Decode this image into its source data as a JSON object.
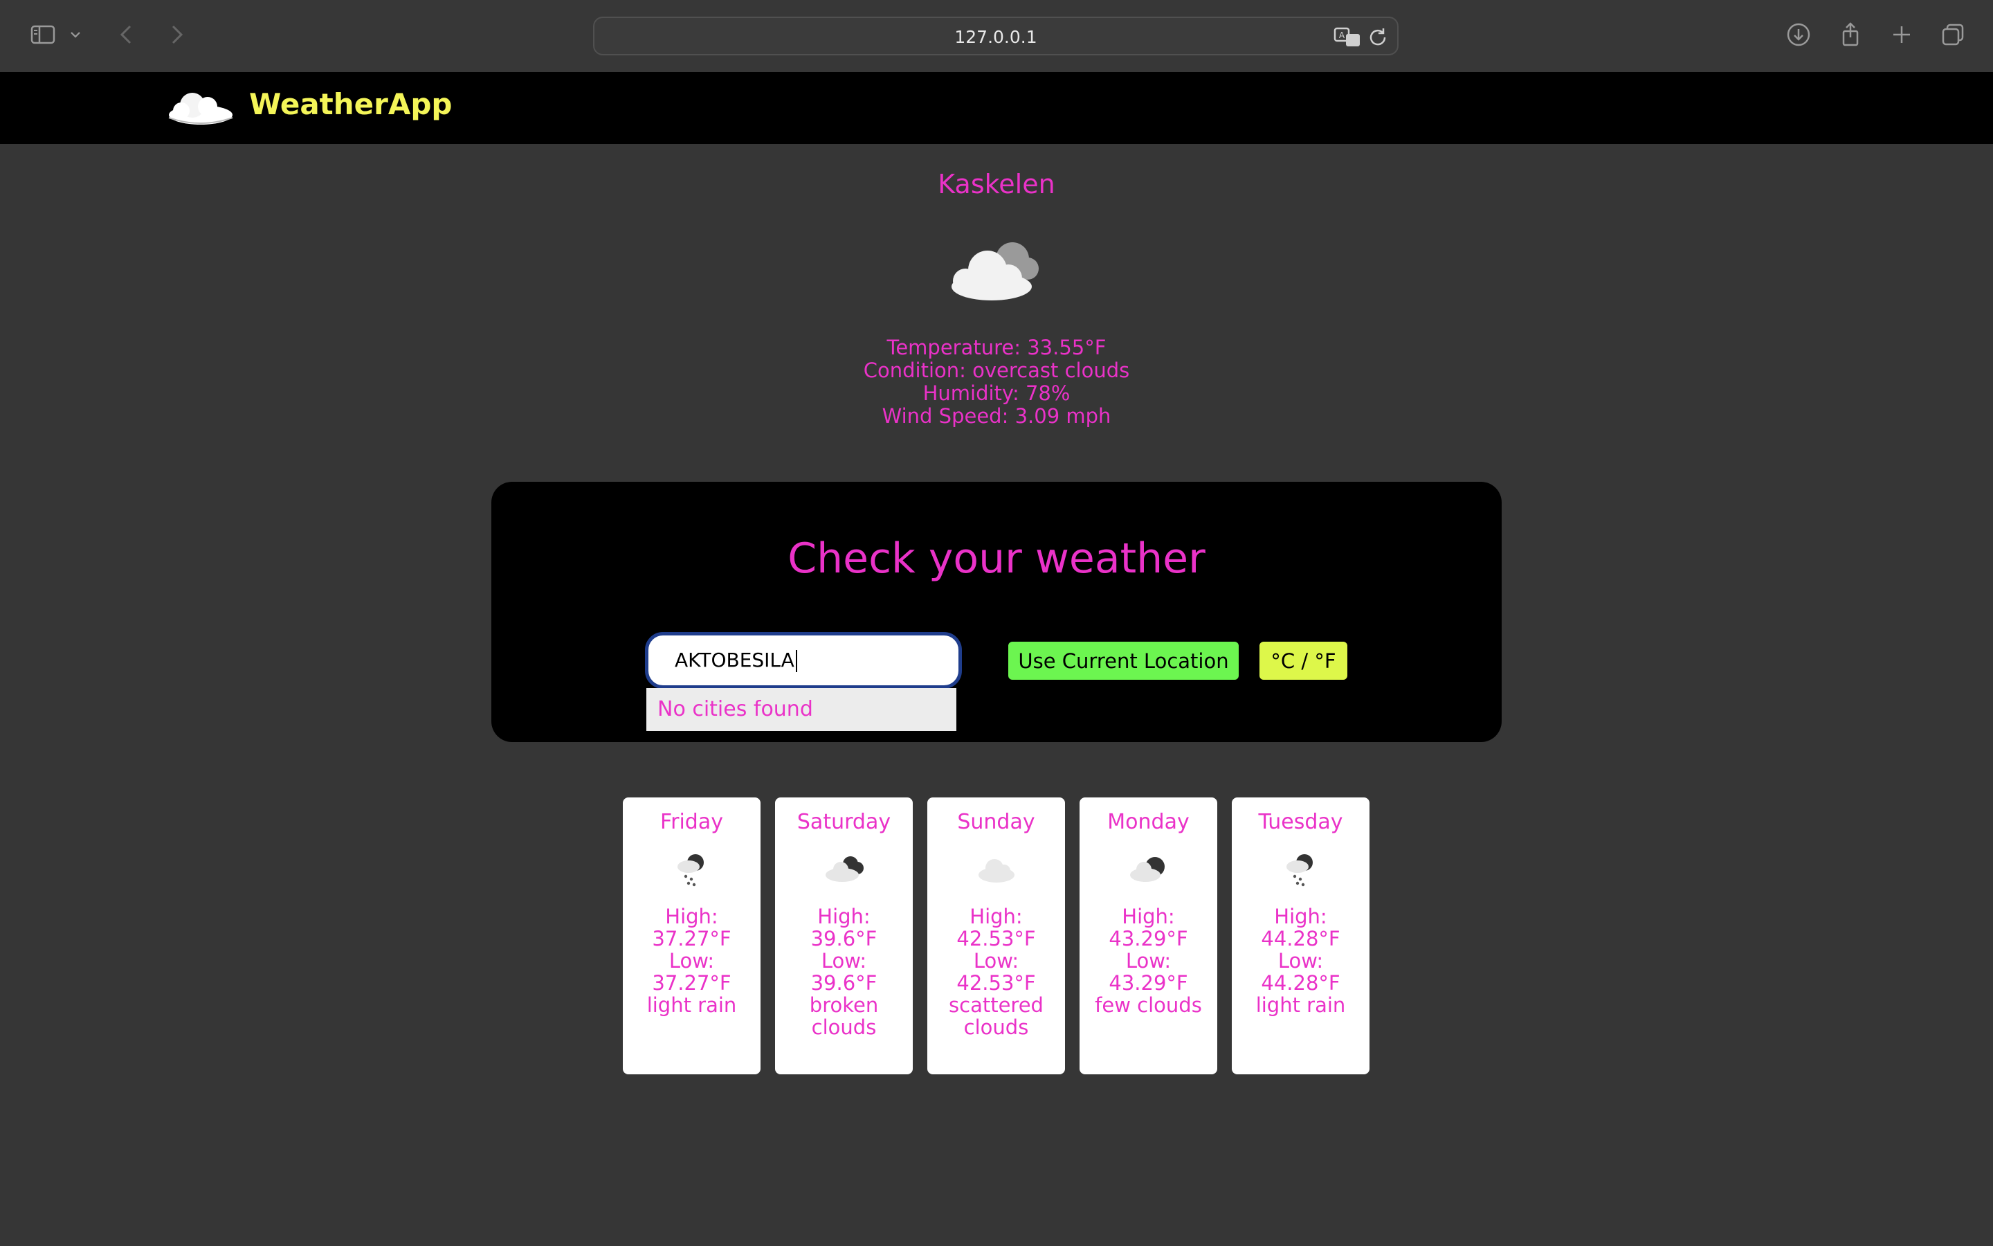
{
  "browser": {
    "url": "127.0.0.1"
  },
  "app": {
    "brand": "WeatherApp"
  },
  "current": {
    "city": "Kaskelen",
    "temperature": "Temperature: 33.55°F",
    "condition": "Condition: overcast clouds",
    "humidity": "Humidity: 78%",
    "wind": "Wind Speed: 3.09 mph",
    "icon": "overcast-cloud-icon"
  },
  "search": {
    "title": "Check your weather",
    "input_value": "AKTOBESILA",
    "dropdown_message": "No cities found",
    "location_button": "Use Current Location",
    "unit_button": "°C / °F"
  },
  "forecast": [
    {
      "day": "Friday",
      "high_label": "High:",
      "high": "37.27°F",
      "low_label": "Low:",
      "low": "37.27°F",
      "desc": "light rain",
      "icon": "light-rain-icon"
    },
    {
      "day": "Saturday",
      "high_label": "High:",
      "high": "39.6°F",
      "low_label": "Low:",
      "low": "39.6°F",
      "desc": "broken clouds",
      "icon": "broken-clouds-icon"
    },
    {
      "day": "Sunday",
      "high_label": "High:",
      "high": "42.53°F",
      "low_label": "Low:",
      "low": "42.53°F",
      "desc": "scattered clouds",
      "icon": "scattered-clouds-icon"
    },
    {
      "day": "Monday",
      "high_label": "High:",
      "high": "43.29°F",
      "low_label": "Low:",
      "low": "43.29°F",
      "desc": "few clouds",
      "icon": "few-clouds-icon"
    },
    {
      "day": "Tuesday",
      "high_label": "High:",
      "high": "44.28°F",
      "low_label": "Low:",
      "low": "44.28°F",
      "desc": "light rain",
      "icon": "light-rain-icon"
    }
  ],
  "colors": {
    "accent": "#ea32c8",
    "brand": "#f4f558",
    "location_button": "#6cf550",
    "unit_button": "#ddf74a"
  }
}
